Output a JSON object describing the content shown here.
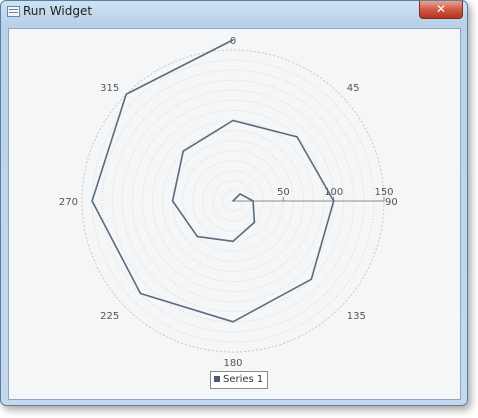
{
  "window": {
    "title": "Run Widget",
    "close_glyph": "✕"
  },
  "chart_data": {
    "type": "radar-line",
    "angle_labels": [
      "0",
      "45",
      "90",
      "135",
      "180",
      "225",
      "270",
      "315"
    ],
    "radial_tick_labels": [
      "50",
      "100",
      "150"
    ],
    "radial_range": [
      0,
      150
    ],
    "grid": true,
    "legend_position": "bottom-center",
    "series": [
      {
        "name": "Series 1",
        "color": "#5a6b80",
        "points": [
          {
            "angle": 0,
            "r": 0
          },
          {
            "angle": 45,
            "r": 10
          },
          {
            "angle": 90,
            "r": 20
          },
          {
            "angle": 135,
            "r": 30
          },
          {
            "angle": 180,
            "r": 40
          },
          {
            "angle": 225,
            "r": 50
          },
          {
            "angle": 270,
            "r": 60
          },
          {
            "angle": 315,
            "r": 70
          },
          {
            "angle": 0,
            "r": 80
          },
          {
            "angle": 45,
            "r": 90
          },
          {
            "angle": 90,
            "r": 100
          },
          {
            "angle": 135,
            "r": 110
          },
          {
            "angle": 180,
            "r": 120
          },
          {
            "angle": 225,
            "r": 130
          },
          {
            "angle": 270,
            "r": 140
          },
          {
            "angle": 315,
            "r": 150
          },
          {
            "angle": 0,
            "r": 160
          }
        ]
      }
    ]
  }
}
